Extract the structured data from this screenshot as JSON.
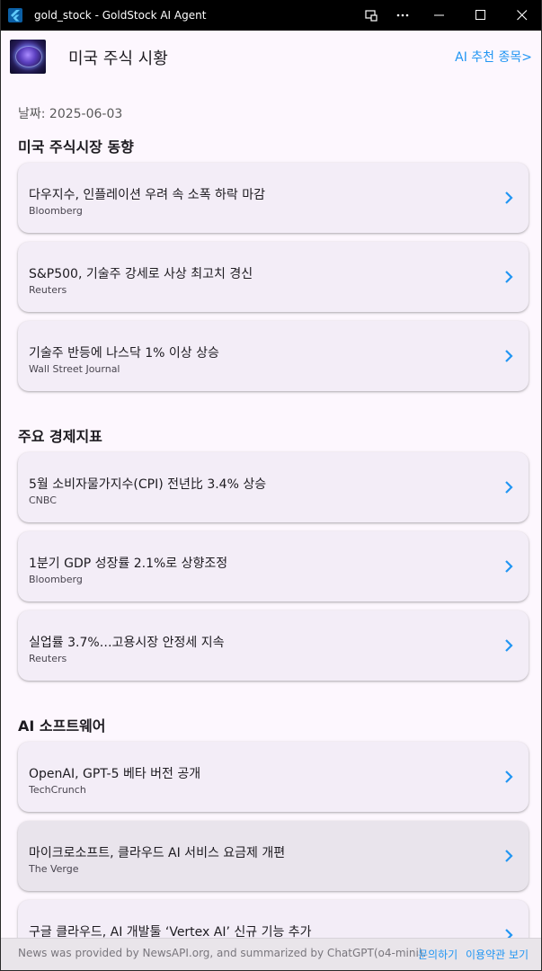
{
  "window": {
    "title": "gold_stock - GoldStock AI Agent"
  },
  "appbar": {
    "title": "미국 주식 시황",
    "ai_link": "AI 추천 종목>"
  },
  "date_label": "날짜: 2025-06-03",
  "sections": [
    {
      "title": "미국 주식시장 동향",
      "items": [
        {
          "title": "다우지수, 인플레이션 우려 속 소폭 하락 마감",
          "source": "Bloomberg"
        },
        {
          "title": "S&P500, 기술주 강세로 사상 최고치 경신",
          "source": "Reuters"
        },
        {
          "title": "기술주 반등에 나스닥 1% 이상 상승",
          "source": "Wall Street Journal"
        }
      ]
    },
    {
      "title": "주요 경제지표",
      "items": [
        {
          "title": "5월 소비자물가지수(CPI) 전년比 3.4% 상승",
          "source": "CNBC"
        },
        {
          "title": "1분기 GDP 성장률 2.1%로 상향조정",
          "source": "Bloomberg"
        },
        {
          "title": "실업률 3.7%…고용시장 안정세 지속",
          "source": "Reuters"
        }
      ]
    },
    {
      "title": "AI 소프트웨어",
      "items": [
        {
          "title": "OpenAI, GPT-5 베타 버전 공개",
          "source": "TechCrunch"
        },
        {
          "title": "마이크로소프트, 클라우드 AI 서비스 요금제 개편",
          "source": "The Verge"
        },
        {
          "title": "구글 클라우드, AI 개발툴 ‘Vertex AI’ 신규 기능 추가",
          "source": ""
        }
      ]
    }
  ],
  "footer": {
    "note": "News was provided by NewsAPI.org, and summarized by ChatGPT(o4-mini).",
    "contact": "문의하기",
    "terms": "이용약관 보기"
  },
  "colors": {
    "accent": "#2196f3",
    "card_bg": "#f3edf7",
    "page_bg": "#fdf7fe"
  }
}
